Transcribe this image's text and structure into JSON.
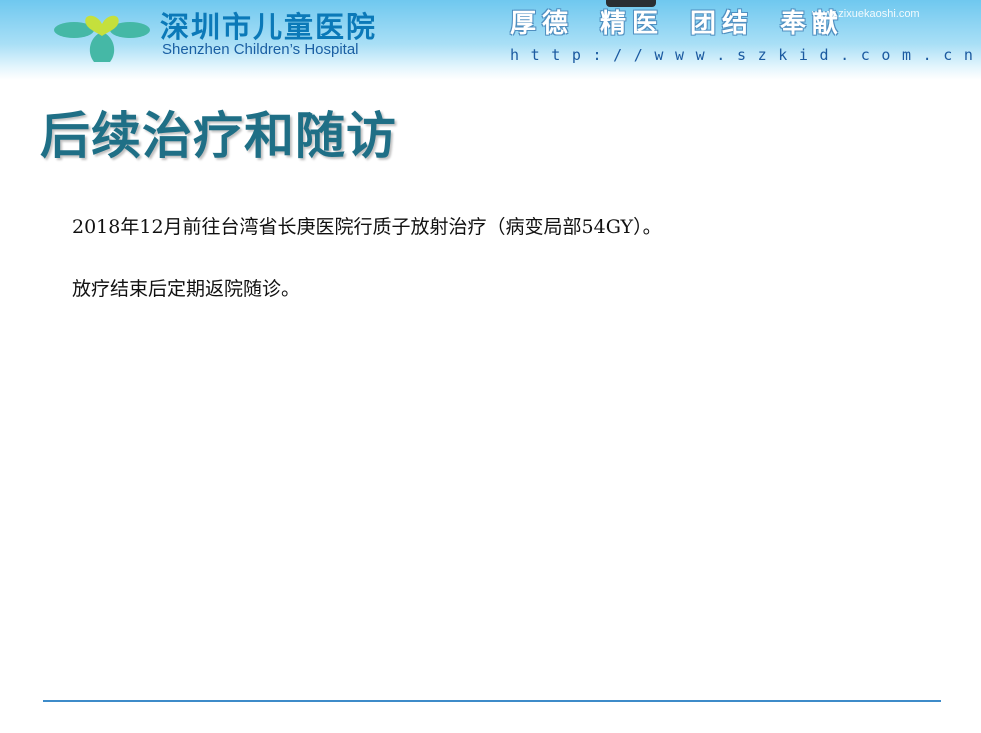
{
  "header": {
    "hospital_name_cn": "深圳市儿童医院",
    "hospital_name_en": "Shenzhen Children’s Hospital",
    "motto": [
      "厚德",
      "精医",
      "团结",
      "奉献"
    ],
    "url": "http://www.szkid.com.cn",
    "watermark": "www.zixuekaoshi.com"
  },
  "slide": {
    "title": "后续治疗和随访",
    "paragraphs": [
      "2018年12月前往台湾省长庚医院行质子放射治疗（病变局部54GY）。",
      "放疗结束后定期返院随诊。"
    ]
  },
  "colors": {
    "title": "#1f6f86",
    "header_top": "#6fc8ef",
    "logo_green": "#45b8a6",
    "logo_heart": "#c5e03c",
    "footer_line": "#3d8bc9"
  },
  "icons": [
    "hospital-logo-icon"
  ]
}
